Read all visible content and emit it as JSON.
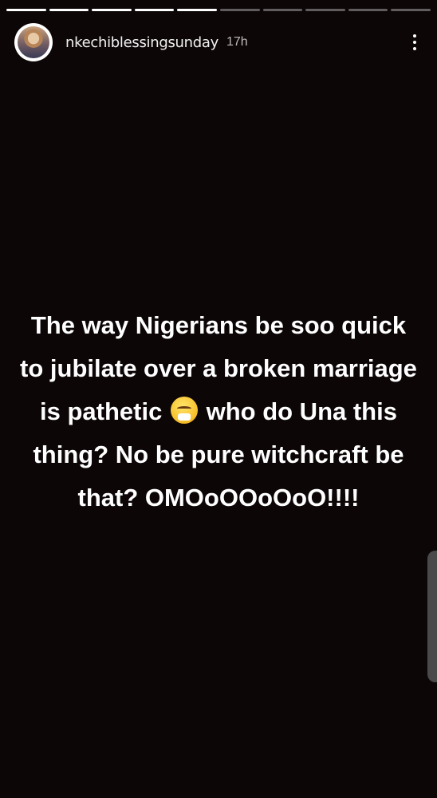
{
  "story": {
    "progress": {
      "total": 10,
      "completed": 5
    },
    "username": "nkechiblessingsunday",
    "time_ago": "17h",
    "text_before_emoji": "The way Nigerians be soo quick to jubilate over a broken marriage is pathetic",
    "emoji": "face-with-steam-from-nose",
    "text_after_emoji": "who do Una this thing? No be pure witchcraft be that? OMOoOOoOoO!!!!"
  }
}
